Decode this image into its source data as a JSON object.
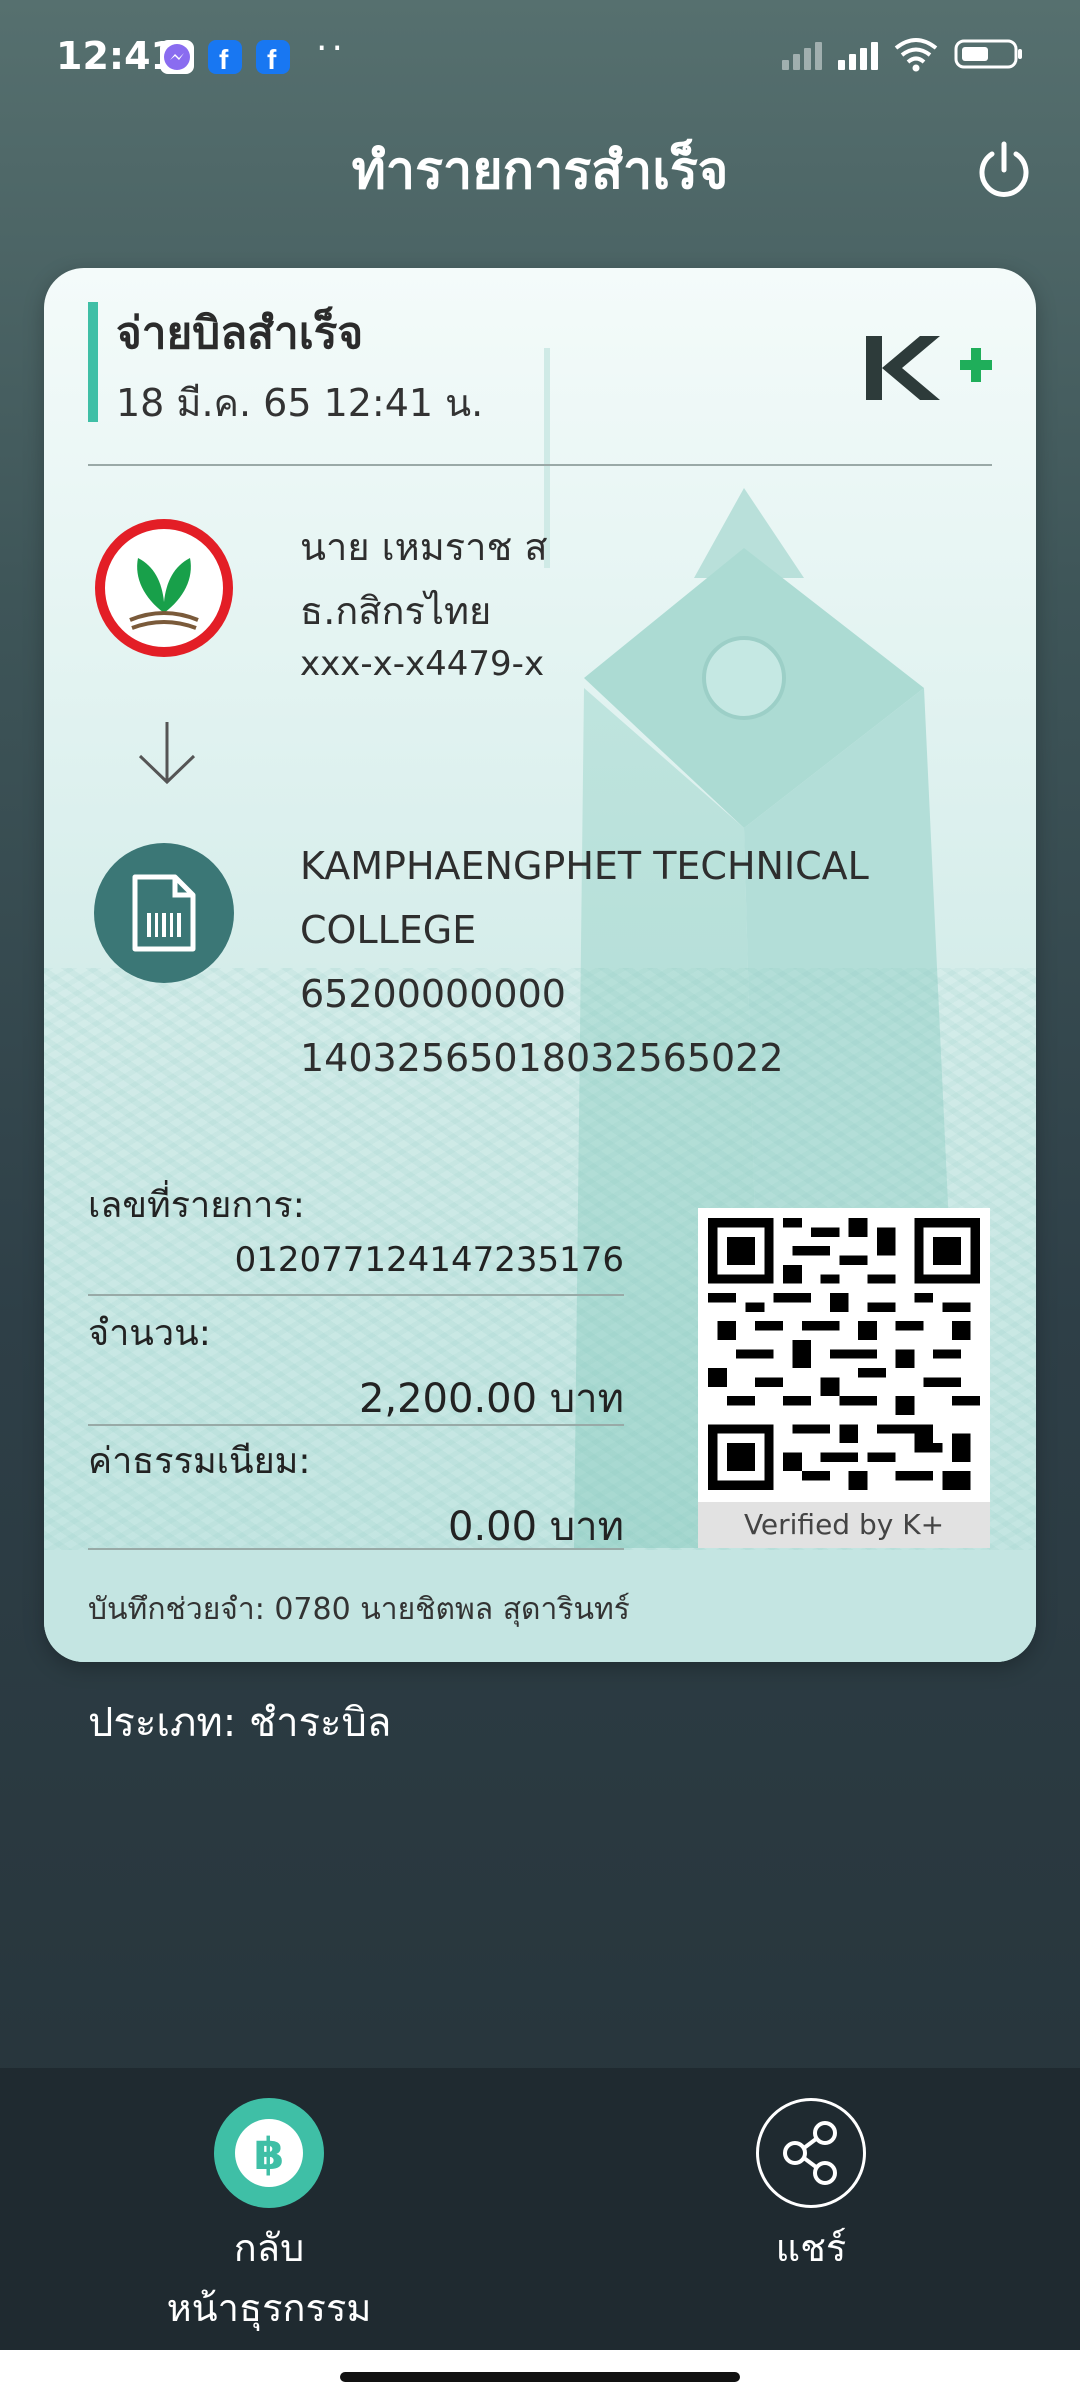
{
  "status_bar": {
    "time": "12:41",
    "dots": "··",
    "icons": [
      "messenger-icon",
      "facebook-icon",
      "facebook-icon",
      "signal-icon",
      "signal-icon",
      "wifi-icon",
      "battery-icon"
    ]
  },
  "header": {
    "title": "ทำรายการสำเร็จ",
    "power_icon": "power-icon"
  },
  "receipt": {
    "title": "จ่ายบิลสำเร็จ",
    "datetime": "18 มี.ค. 65  12:41 น.",
    "brand_logo": "K+",
    "accent_color": "#3fbfa6",
    "from": {
      "name": "นาย เหมราช ส",
      "bank": "ธ.กสิกรไทย",
      "account": "xxx-x-x4479-x"
    },
    "to": {
      "name_line1": "KAMPHAENGPHET TECHNICAL",
      "name_line2": "COLLEGE",
      "ref1": "65200000000",
      "ref2": "14032565018032565022"
    },
    "fields": {
      "txn_label": "เลขที่รายการ:",
      "txn_value": "012077124147235176",
      "amount_label": "จำนวน:",
      "amount_value": "2,200.00 บาท",
      "fee_label": "ค่าธรรมเนียม:",
      "fee_value": "0.00 บาท"
    },
    "qr_caption": "Verified by K+",
    "memo": "บันทึกช่วยจำ: 0780 นายชิตพล สุดารินทร์"
  },
  "type_line": "ประเภท: ชำระบิล",
  "bottom_nav": {
    "back_label_1": "กลับ",
    "back_label_2": "หน้าธุรกรรม",
    "back_icon": "baht-icon",
    "share_label": "แชร์",
    "share_icon": "share-icon"
  }
}
